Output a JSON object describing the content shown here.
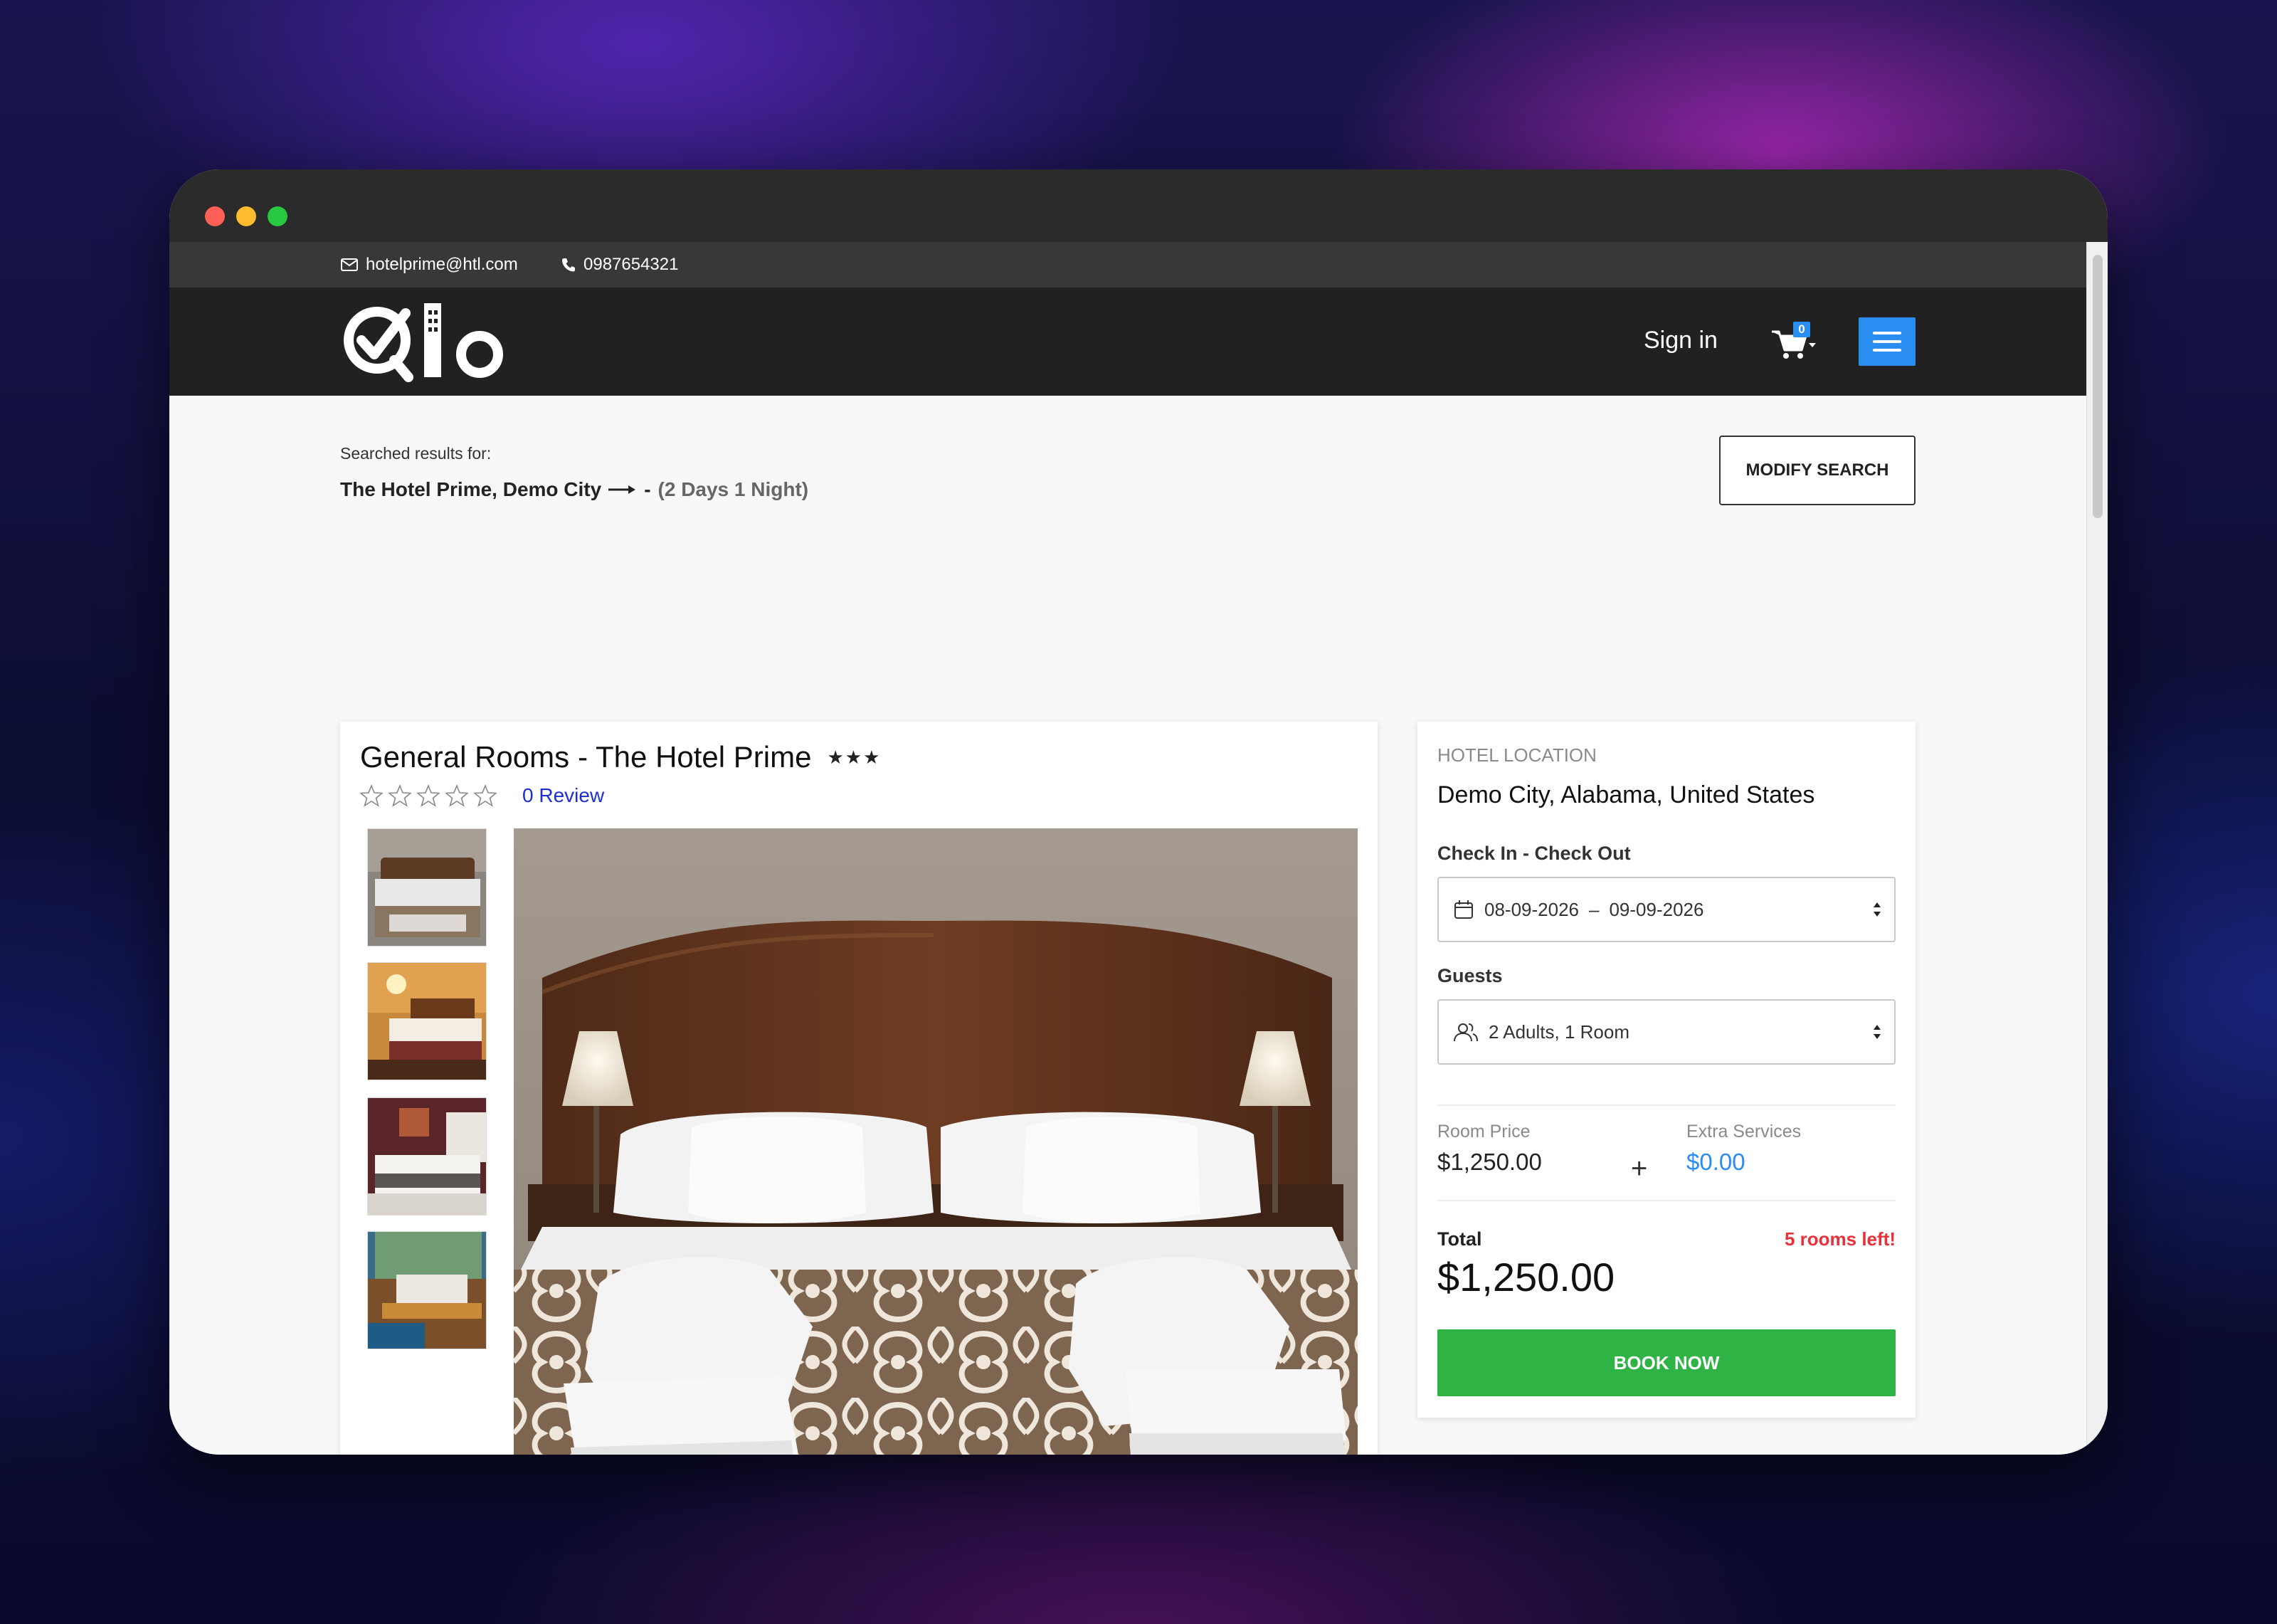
{
  "topbar": {
    "email": "hotelprime@htl.com",
    "phone": "0987654321"
  },
  "header": {
    "logo_text": "Qlo",
    "signin_label": "Sign in",
    "cart_count": "0"
  },
  "search": {
    "label": "Searched results for:",
    "destination": "The Hotel Prime, Demo City",
    "separator": "-",
    "nights": "(2 Days 1 Night)",
    "modify_label": "MODIFY SEARCH"
  },
  "room": {
    "name": "General Rooms",
    "hotel": "- The Hotel Prime",
    "hotel_stars": "★★★",
    "rating": 0,
    "rating_max": 5,
    "reviews_label": "0 Review"
  },
  "booking": {
    "location_label": "HOTEL LOCATION",
    "location": "Demo City, Alabama, United States",
    "dates_label": "Check In - Check Out",
    "check_in": "08-09-2026",
    "date_separator": "–",
    "check_out": "09-09-2026",
    "guests_label": "Guests",
    "guests_value": "2 Adults, 1 Room",
    "room_price_label": "Room Price",
    "room_price": "$1,250.00",
    "plus": "+",
    "extra_label": "Extra Services",
    "extra_value": "$0.00",
    "total_label": "Total",
    "rooms_left": "5 rooms left!",
    "total_value": "$1,250.00",
    "book_label": "BOOK NOW"
  },
  "colors": {
    "accent_blue": "#2a8df2",
    "book_green": "#2fb344",
    "alert_red": "#e8323a",
    "link_blue": "#1c2fd1",
    "header_bg": "#212121"
  }
}
